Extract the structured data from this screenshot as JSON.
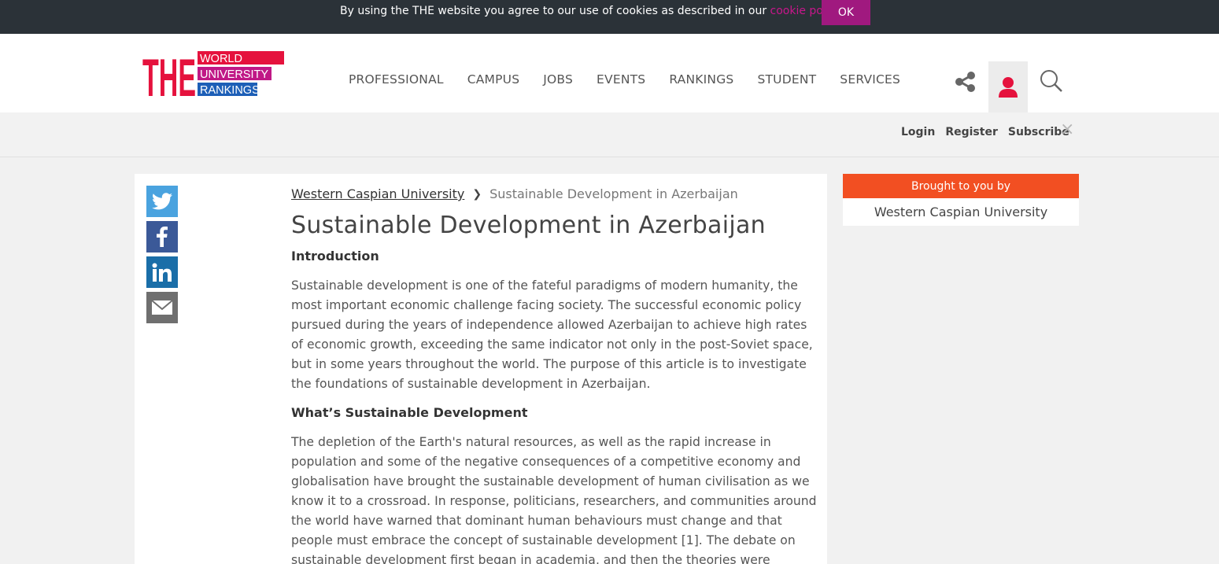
{
  "cookie_bar": {
    "text_before": "By using the THE website you agree to our use of cookies as described in our ",
    "link_text": "cookie policy",
    "text_after": ".",
    "ok_label": "OK"
  },
  "logo": {
    "letters": "THE",
    "line1": "WORLD",
    "line2": "UNIVERSITY",
    "line3": "RANKINGS"
  },
  "nav": {
    "items": [
      "PROFESSIONAL",
      "CAMPUS",
      "JOBS",
      "EVENTS",
      "RANKINGS",
      "STUDENT",
      "SERVICES"
    ]
  },
  "account": {
    "login": "Login",
    "register": "Register",
    "subscribe": "Subscribe",
    "close": "×"
  },
  "breadcrumb": {
    "parent": "Western Caspian University",
    "current": "Sustainable Development in Azerbaijan"
  },
  "article": {
    "title": "Sustainable Development in Azerbaijan",
    "intro_heading": "Introduction",
    "intro_para": "Sustainable development is one of the fateful paradigms of modern humanity, the most important economic challenge facing society. The successful economic policy pursued during the years of independence allowed Azerbaijan to achieve high rates of economic growth, exceeding the same indicator not only in the post-Soviet space, but in some years throughout the world. The purpose of this article is to investigate the foundations of sustainable development in Azerbaijan.",
    "what_heading": "What’s Sustainable Development",
    "what_para": "The depletion of the Earth's natural resources, as well as the rapid increase in population and some of the negative consequences of a competitive economy and globalisation have brought the sustainable development of human civilisation as we know it to a crossroad. In response, politicians, researchers, and communities around the world have warned that dominant human behaviours must change and that people must embrace the concept of sustainable development [1]. The debate on sustainable development first began in academia, and then the theories were brought to the entire world community."
  },
  "sponsor": {
    "heading": "Brought to you by",
    "name": "Western Caspian University"
  },
  "icons": {
    "share": "share-icon",
    "user": "user-icon",
    "search": "search-icon",
    "twitter": "twitter-icon",
    "facebook": "facebook-icon",
    "linkedin": "linkedin-icon",
    "email": "email-icon"
  },
  "colors": {
    "cookie_bar": "#2b3238",
    "ok_button": "#a0197f",
    "cookie_link": "#c9168c",
    "logo_red": "#e5123d",
    "logo_magenta": "#c01886",
    "logo_blue": "#1d5fb7",
    "user_icon": "#e5123d",
    "sponsor_header": "#f24f22"
  }
}
